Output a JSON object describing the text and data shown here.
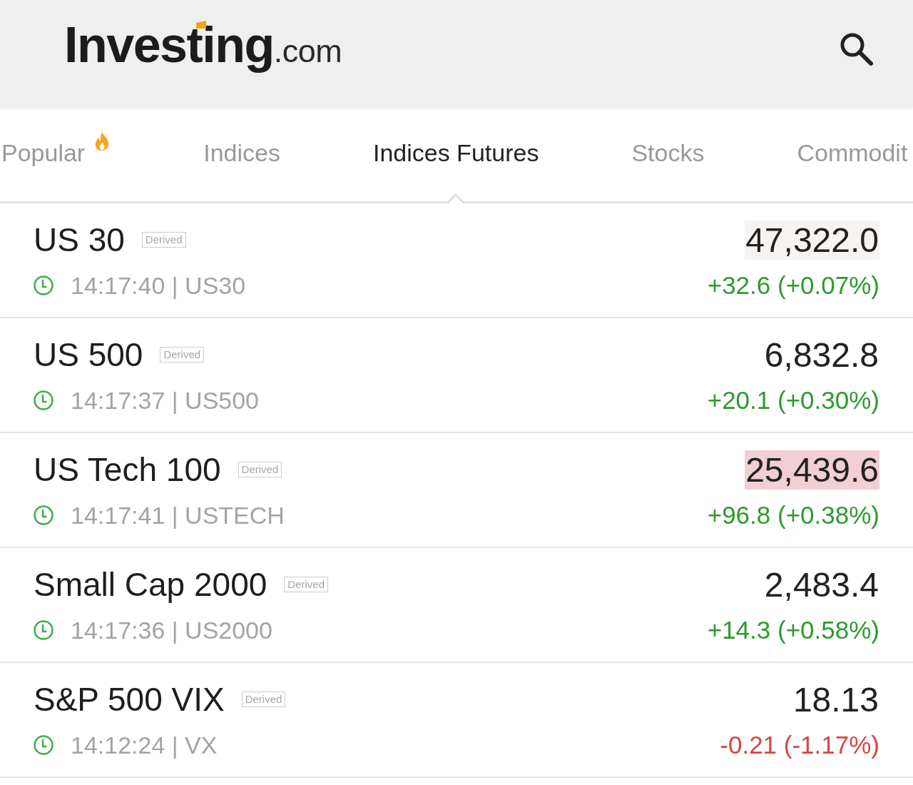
{
  "header": {
    "logo": {
      "wordmark": "Investing",
      "suffix": ".com"
    }
  },
  "tabs": [
    {
      "label": "Popular",
      "selected": false,
      "hot": true
    },
    {
      "label": "Indices",
      "selected": false,
      "hot": false
    },
    {
      "label": "Indices Futures",
      "selected": true,
      "hot": false
    },
    {
      "label": "Stocks",
      "selected": false,
      "hot": false
    },
    {
      "label": "Commodit",
      "selected": false,
      "hot": false
    }
  ],
  "quotes": [
    {
      "name": "US 30",
      "tag": "Derived",
      "live": true,
      "info": "14:17:40 | US30",
      "price": "47,322.0",
      "flashing": true,
      "color": "#f7f3f1",
      "change": "+32.6 (+0.07%)",
      "rising": true
    },
    {
      "name": "US 500",
      "tag": "Derived",
      "live": true,
      "info": "14:17:37 | US500",
      "price": "6,832.8",
      "flashing": false,
      "change": "+20.1 (+0.30%)",
      "rising": true
    },
    {
      "name": "US Tech 100",
      "tag": "Derived",
      "live": true,
      "info": "14:17:41 | USTECH",
      "price": "25,439.6",
      "flashing": true,
      "color": "#f2cfd5",
      "change": "+96.8 (+0.38%)",
      "rising": true
    },
    {
      "name": "Small Cap 2000",
      "tag": "Derived",
      "live": true,
      "info": "14:17:36 | US2000",
      "price": "2,483.4",
      "flashing": false,
      "change": "+14.3 (+0.58%)",
      "rising": true
    },
    {
      "name": "S&P 500 VIX",
      "tag": "Derived",
      "live": true,
      "info": "14:12:24 | VX",
      "price": "18.13",
      "flashing": false,
      "change": "-0.21 (-1.17%)",
      "rising": false
    }
  ]
}
